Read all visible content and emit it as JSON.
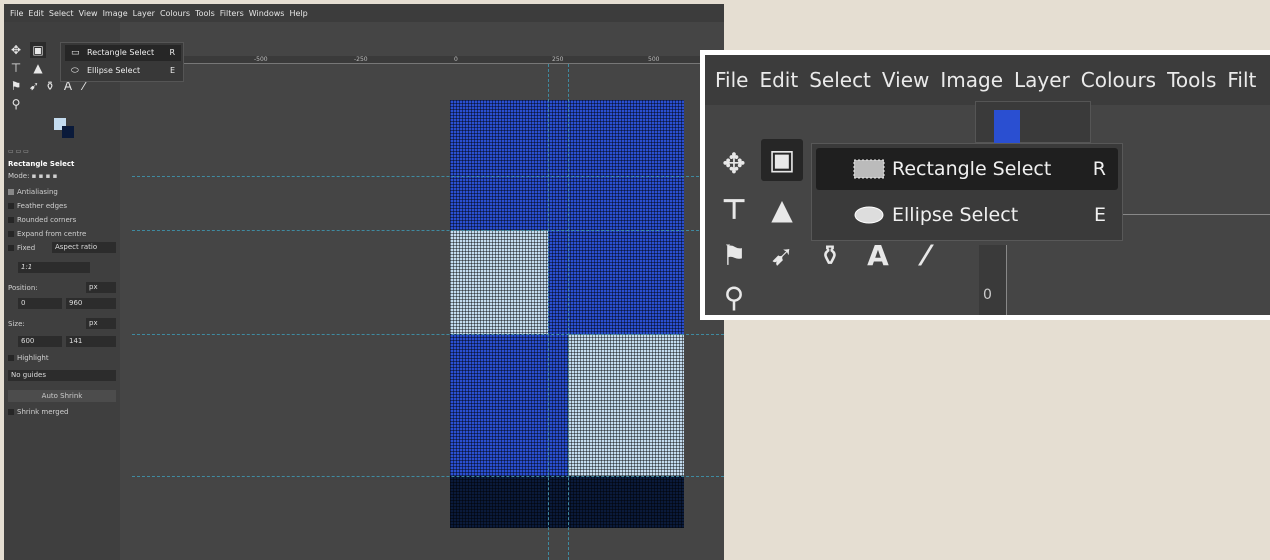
{
  "menu": [
    "File",
    "Edit",
    "Select",
    "View",
    "Image",
    "Layer",
    "Colours",
    "Tools",
    "Filters",
    "Windows",
    "Help"
  ],
  "zoom_menu": [
    "File",
    "Edit",
    "Select",
    "View",
    "Image",
    "Layer",
    "Colours",
    "Tools",
    "Filt"
  ],
  "flyout": {
    "items": [
      {
        "label": "Rectangle Select",
        "shortcut": "R"
      },
      {
        "label": "Ellipse Select",
        "shortcut": "E"
      }
    ]
  },
  "tool_options": {
    "title": "Rectangle Select",
    "mode_label": "Mode:",
    "antialiasing": "Antialiasing",
    "feather_edges": "Feather edges",
    "rounded_corners": "Rounded corners",
    "expand_from_centre": "Expand from centre",
    "fixed": "Fixed",
    "aspect_ratio": "Aspect ratio",
    "ratio_value": "1:1",
    "position_label": "Position:",
    "position_unit": "px",
    "position_x": "0",
    "position_y": "960",
    "size_label": "Size:",
    "size_unit": "px",
    "size_w": "600",
    "size_h": "141",
    "highlight": "Highlight",
    "guides": "No guides",
    "auto_shrink": "Auto Shrink",
    "shrink_merged": "Shrink merged"
  },
  "ruler": {
    "labels": [
      "-500",
      "-250",
      "0",
      "250",
      "500"
    ],
    "v_label": "0"
  },
  "colors": {
    "fg": "#2a4fd1",
    "light": "#c4dcf0",
    "dark": "#0a1a3a"
  }
}
